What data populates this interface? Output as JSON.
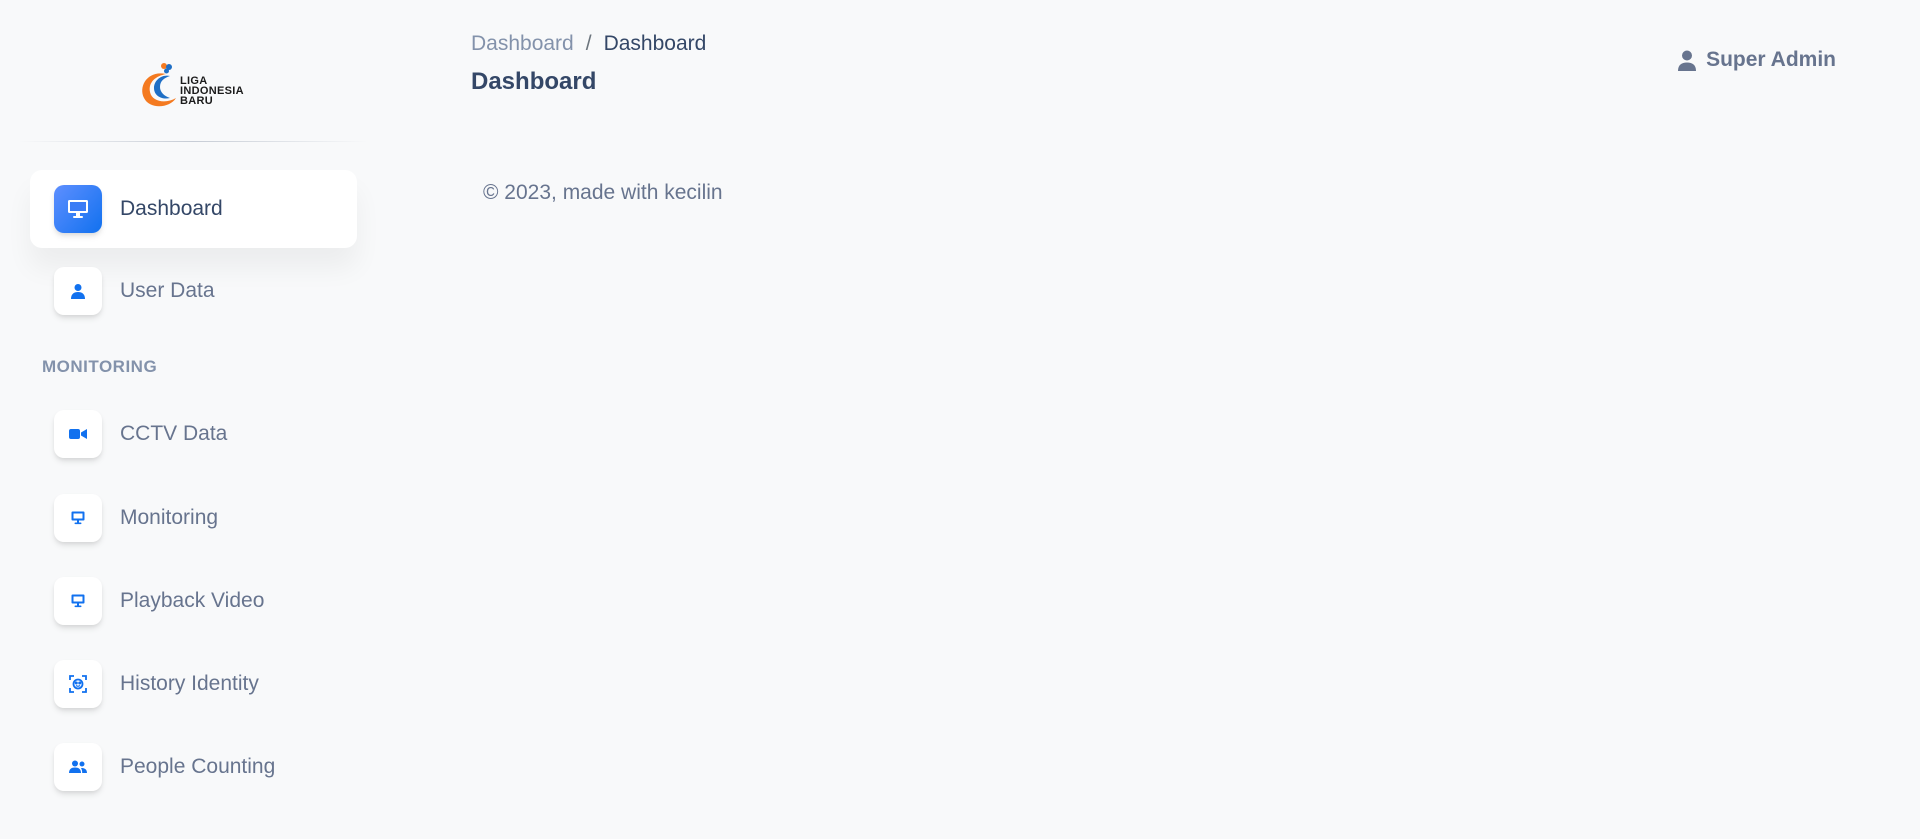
{
  "logo": {
    "line1": "LIGA",
    "line2": "INDONESIA",
    "line3": "BARU"
  },
  "sidebar": {
    "items": [
      {
        "label": "Dashboard",
        "icon": "desktop-icon",
        "active": true
      },
      {
        "label": "User Data",
        "icon": "user-icon",
        "active": false
      }
    ],
    "section_label": "MONITORING",
    "monitoring_items": [
      {
        "label": "CCTV Data",
        "icon": "video-camera-icon"
      },
      {
        "label": "Monitoring",
        "icon": "desktop-icon"
      },
      {
        "label": "Playback Video",
        "icon": "desktop-icon"
      },
      {
        "label": "History Identity",
        "icon": "face-scan-icon"
      },
      {
        "label": "People Counting",
        "icon": "users-icon"
      }
    ]
  },
  "header": {
    "breadcrumb": {
      "parent": "Dashboard",
      "separator": "/",
      "current": "Dashboard"
    },
    "title": "Dashboard",
    "user_name": "Super Admin"
  },
  "footer": {
    "text": "© 2023, made with kecilin"
  },
  "colors": {
    "accent": "#1171ef",
    "text_primary": "#344767",
    "text_muted": "#67748e",
    "background": "#f8f9fa"
  }
}
